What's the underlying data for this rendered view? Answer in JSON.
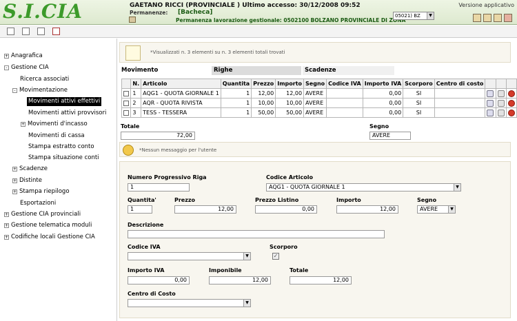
{
  "header": {
    "logo": "S.I.CIA",
    "user": "GAETANO RICCI (PROVINCIALE ) Ultimo accesso: 30/12/2008 09:52",
    "permanenze_label": "Permanenze:",
    "permanenze_value": "[Bacheca]",
    "permanenza_line": "Permanenza lavorazione gestionale: 0502100 BOLZANO PROVINCIALE DI ZONA",
    "office_value": "05021) BZ",
    "versione": "Versione applicativo"
  },
  "sidebar": {
    "items": [
      {
        "label": "Anagrafica",
        "toggle": "+"
      },
      {
        "label": "Gestione CIA",
        "toggle": "-"
      },
      {
        "label": "Ricerca associati",
        "toggle": ""
      },
      {
        "label": "Movimentazione",
        "toggle": "-"
      },
      {
        "label": "Movimenti attivi effettivi",
        "toggle": ""
      },
      {
        "label": "Movimenti attivi provvisori",
        "toggle": ""
      },
      {
        "label": "Movimenti d'incasso",
        "toggle": "+"
      },
      {
        "label": "Movimenti di cassa",
        "toggle": ""
      },
      {
        "label": "Stampa estratto conto",
        "toggle": ""
      },
      {
        "label": "Stampa situazione conti",
        "toggle": ""
      },
      {
        "label": "Scadenze",
        "toggle": "+"
      },
      {
        "label": "Distinte",
        "toggle": "+"
      },
      {
        "label": "Stampa riepilogo",
        "toggle": "+"
      },
      {
        "label": "Esportazioni",
        "toggle": ""
      },
      {
        "label": "Gestione CIA provinciali",
        "toggle": "+"
      },
      {
        "label": "Gestione telematica moduli",
        "toggle": "+"
      },
      {
        "label": "Codifiche locali Gestione CIA",
        "toggle": "+"
      }
    ]
  },
  "info": {
    "text": "*Visualizzati n. 3 elementi su n. 3 elementi totali trovati"
  },
  "sections": {
    "movimento": "Movimento",
    "righe": "Righe",
    "scadenze": "Scadenze"
  },
  "table": {
    "headers": [
      "N.",
      "Articolo",
      "Quantita",
      "Prezzo",
      "Importo",
      "Segno",
      "Codice IVA",
      "Importo IVA",
      "Scorporo",
      "Centro di costo"
    ],
    "rows": [
      {
        "n": "1",
        "articolo": "AQG1 - QUOTA GIORNALE 1",
        "quantita": "1",
        "prezzo": "12,00",
        "importo": "12,00",
        "segno": "AVERE",
        "codice_iva": "",
        "importo_iva": "0,00",
        "scorporo": "SI",
        "centro": ""
      },
      {
        "n": "2",
        "articolo": "AQR - QUOTA RIVISTA",
        "quantita": "1",
        "prezzo": "10,00",
        "importo": "10,00",
        "segno": "AVERE",
        "codice_iva": "",
        "importo_iva": "0,00",
        "scorporo": "SI",
        "centro": ""
      },
      {
        "n": "3",
        "articolo": "TESS - TESSERA",
        "quantita": "1",
        "prezzo": "50,00",
        "importo": "50,00",
        "segno": "AVERE",
        "codice_iva": "",
        "importo_iva": "0,00",
        "scorporo": "SI",
        "centro": ""
      }
    ]
  },
  "totals": {
    "totale_label": "Totale",
    "totale_value": "72,00",
    "segno_label": "Segno",
    "segno_value": "AVERE"
  },
  "message": {
    "text": "*Nessun messaggio per l'utente"
  },
  "form": {
    "numero_label": "Numero Progressivo Riga",
    "numero_value": "1",
    "codice_articolo_label": "Codice Articolo",
    "codice_articolo_value": "AQG1 - QUOTA GIORNALE 1",
    "quantita_label": "Quantita'",
    "quantita_value": "1",
    "prezzo_label": "Prezzo",
    "prezzo_value": "12,00",
    "prezzo_listino_label": "Prezzo Listino",
    "prezzo_listino_value": "0,00",
    "importo_label": "Importo",
    "importo_value": "12,00",
    "segno_label": "Segno",
    "segno_value": "AVERE",
    "descrizione_label": "Descrizione",
    "descrizione_value": "",
    "codice_iva_label": "Codice IVA",
    "codice_iva_value": "",
    "scorporo_label": "Scorporo",
    "importo_iva_label": "Importo IVA",
    "importo_iva_value": "0,00",
    "imponibile_label": "Imponibile",
    "imponibile_value": "12,00",
    "totale_label": "Totale",
    "totale_value": "12,00",
    "centro_label": "Centro di Costo",
    "centro_value": ""
  }
}
